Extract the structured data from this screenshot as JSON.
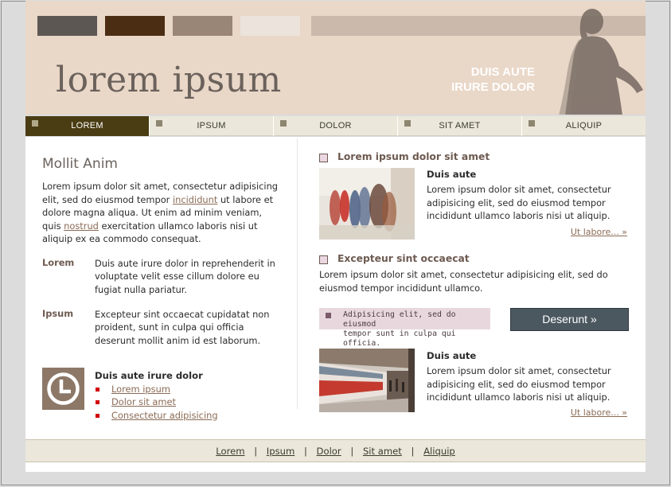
{
  "header": {
    "logo": "lorem ipsum",
    "slogan_line1": "DUIS AUTE",
    "slogan_line2": "IRURE DOLOR"
  },
  "nav": {
    "items": [
      "LOREM",
      "IPSUM",
      "DOLOR",
      "SIT AMET",
      "ALIQUIP"
    ],
    "active": "LOREM"
  },
  "left": {
    "title": "Mollit Anim",
    "intro_1": "Lorem ipsum dolor sit amet, consectetur adipisicing elit, sed do eiusmod tempor ",
    "intro_link1": "incididunt",
    "intro_2": " ut labore et dolore magna aliqua. Ut enim ad minim veniam, quis ",
    "intro_link2": "nostrud",
    "intro_3": " exercitation ullamco laboris nisi ut aliquip ex ea commodo consequat.",
    "defs": [
      {
        "term": "Lorem",
        "desc": "Duis aute irure dolor in reprehenderit in voluptate velit esse cillum dolore eu fugiat nulla pariatur."
      },
      {
        "term": "Ipsum",
        "desc": "Excepteur sint occaecat cupidatat non proident, sunt in culpa qui officia deserunt mollit anim id est laborum."
      }
    ],
    "links_title": "Duis aute irure dolor",
    "links": [
      "Lorem ipsum",
      "Dolor sit amet",
      "Consectetur adipisicing"
    ]
  },
  "right": {
    "section1_title": "Lorem ipsum dolor sit amet",
    "article1": {
      "heading": "Duis aute",
      "text": "Lorem ipsum dolor sit amet, consectetur adipisicing elit, sed do eiusmod tempor incididunt ullamco laboris nisi ut aliquip.",
      "more": "Ut labore... »"
    },
    "section2_title": "Excepteur sint occaecat",
    "section2_text": "Lorem ipsum dolor sit amet, consectetur adipisicing elit, sed do eiusmod tempor incididunt ullamco.",
    "note_line1": "Adipisicing elit, sed do eiusmod",
    "note_line2": "tempor sunt in culpa qui officia.",
    "button": "Deserunt »",
    "article2": {
      "heading": "Duis aute",
      "text": "Lorem ipsum dolor sit amet, consectetur adipisicing elit, sed do eiusmod tempor incididunt ullamco laboris nisi ut aliquip.",
      "more": "Ut labore... »"
    }
  },
  "footer": {
    "links": [
      "Lorem",
      "Ipsum",
      "Dolor",
      "Sit amet",
      "Aliquip"
    ],
    "separator": "|"
  },
  "icons": {
    "clock": "clock-icon",
    "bullet": "square-bullet-icon"
  },
  "colors": {
    "header_bg": "#e9d7c8",
    "nav_active": "#4a3c13",
    "accent_link": "#8b6b56",
    "bullet_red": "#d10000",
    "button_bg": "#4c5860"
  }
}
